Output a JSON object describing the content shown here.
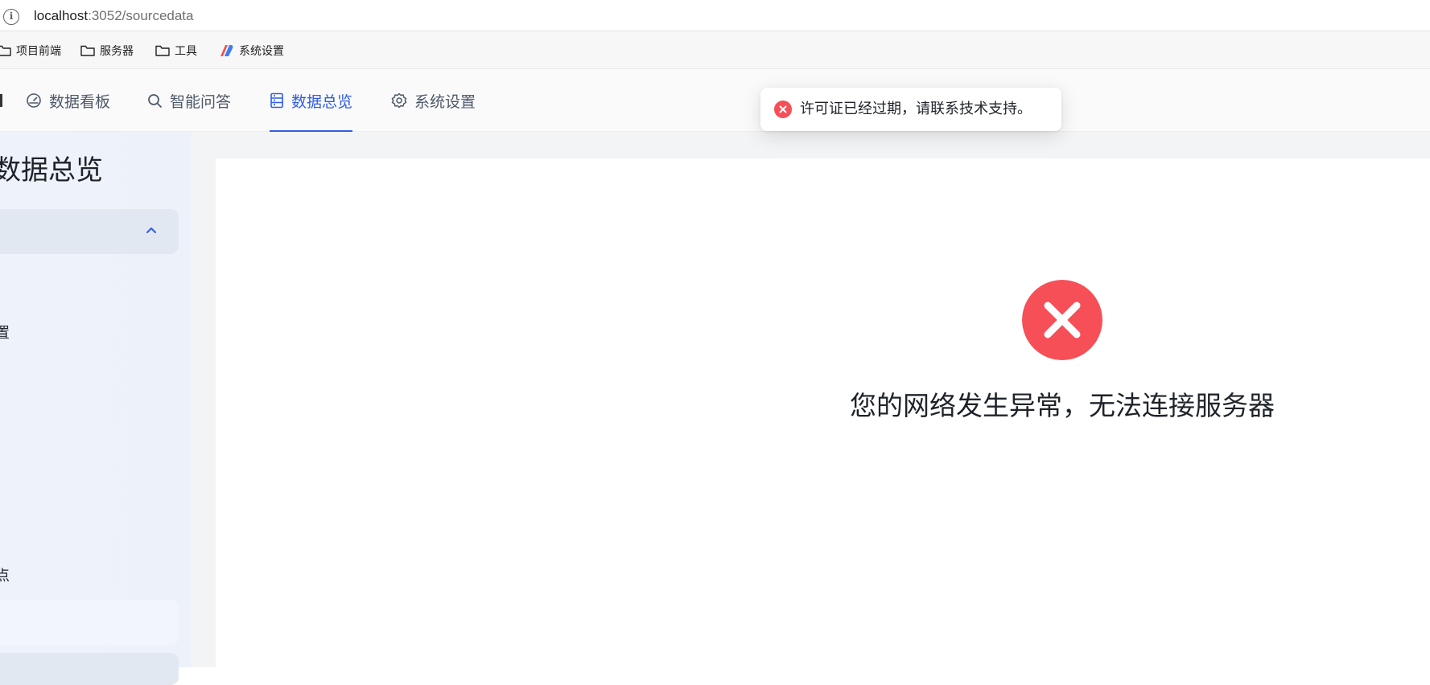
{
  "browser": {
    "url_host": "localhost",
    "url_path": ":3052/sourcedata",
    "bookmarks": [
      {
        "label": "项目前端",
        "icon": "folder-icon"
      },
      {
        "label": "服务器",
        "icon": "folder-icon"
      },
      {
        "label": "工具",
        "icon": "folder-icon"
      },
      {
        "label": "系统设置",
        "icon": "app-logo-icon"
      }
    ]
  },
  "nav": {
    "tabs": [
      {
        "label": "数据看板",
        "icon": "dashboard-icon",
        "active": false
      },
      {
        "label": "智能问答",
        "icon": "search-icon",
        "active": false
      },
      {
        "label": "数据总览",
        "icon": "database-icon",
        "active": true
      },
      {
        "label": "系统设置",
        "icon": "gear-icon",
        "active": false
      }
    ]
  },
  "sidebar": {
    "title": "数据总览",
    "fragment_1": "置",
    "fragment_2": "点"
  },
  "toast": {
    "message": "许可证已经过期，请联系技术支持。",
    "color": "#f64f57"
  },
  "main": {
    "error_message": "您的网络发生异常，无法连接服务器",
    "error_color": "#f64f57"
  },
  "colors": {
    "accent": "#2f5ce8",
    "error": "#f64f57"
  }
}
